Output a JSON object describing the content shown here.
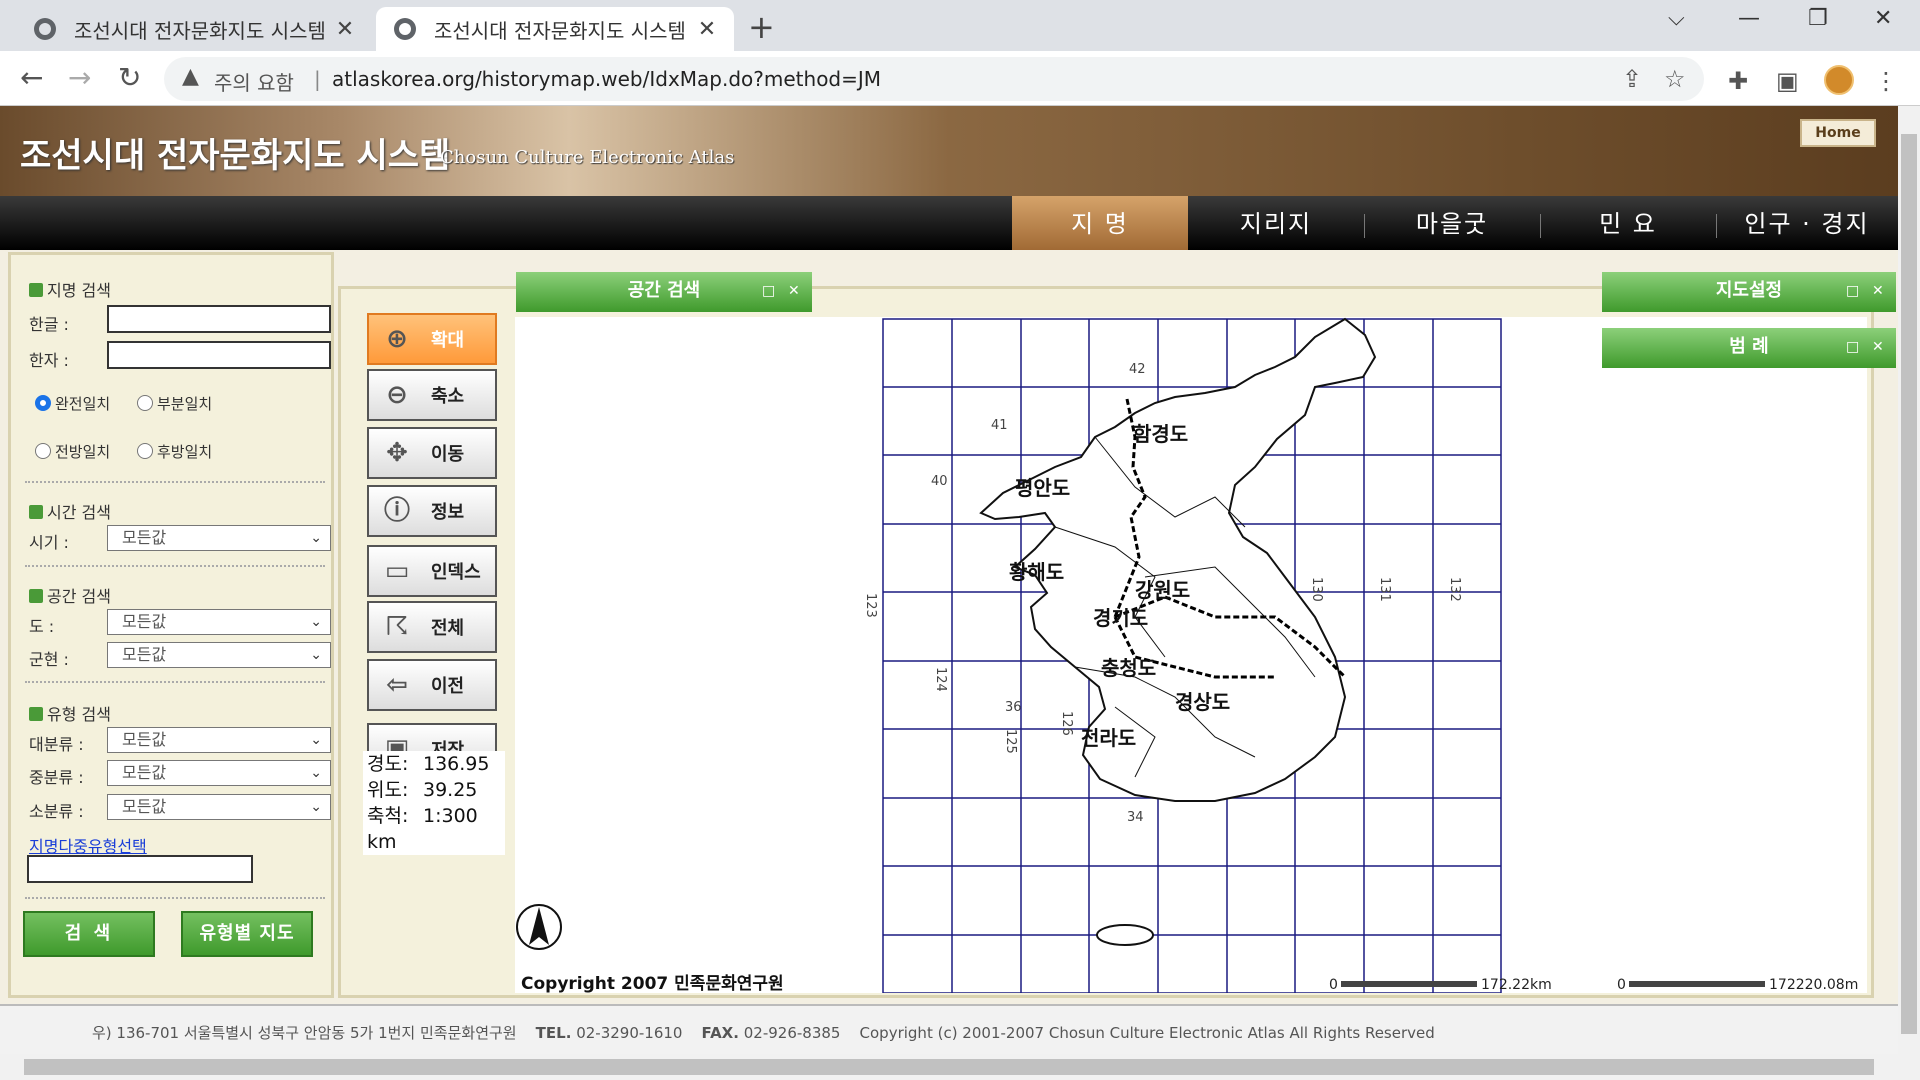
{
  "browser": {
    "tabs": [
      {
        "title": "조선시대 전자문화지도 시스템"
      },
      {
        "title": "조선시대 전자문화지도 시스템"
      }
    ],
    "warning": "주의 요함",
    "url": "atlaskorea.org/historymap.web/IdxMap.do?method=JM"
  },
  "site": {
    "title": "조선시대 전자문화지도 시스템",
    "subtitle": "Chosun Culture Electronic Atlas",
    "home": "Home",
    "menu": [
      "지 명",
      "지리지",
      "마을굿",
      "민 요",
      "인구 · 경지"
    ]
  },
  "search": {
    "name_section": "지명 검색",
    "hangul_label": "한글 :",
    "hanja_label": "한자 :",
    "match_options": [
      "완전일치",
      "부분일치",
      "전방일치",
      "후방일치"
    ],
    "time_section": "시간 검색",
    "period_label": "시기 :",
    "space_section": "공간 검색",
    "do_label": "도 :",
    "county_label": "군현 :",
    "type_section": "유형 검색",
    "major_label": "대분류 :",
    "middle_label": "중분류 :",
    "minor_label": "소분류 :",
    "default_option": "모든값",
    "multi_link": "지명다중유형선택",
    "search_button": "검 색",
    "type_map_button": "유형별 지도"
  },
  "tools": [
    "확대",
    "축소",
    "이동",
    "정보",
    "인덱스",
    "전체",
    "이전",
    "저장"
  ],
  "coords": {
    "lon_label": "경도:",
    "lon_value": "136.95",
    "lat_label": "위도:",
    "lat_value": "39.25",
    "scale_label": "축척:",
    "scale_value": "1:300 km"
  },
  "panels": {
    "space_search": "공간 검색",
    "map_settings": "지도설정",
    "legend": "범 례"
  },
  "map": {
    "provinces": [
      "함경도",
      "평안도",
      "황해도",
      "강원도",
      "경기도",
      "충청도",
      "경상도",
      "전라도"
    ],
    "lat_labels": [
      "42",
      "41",
      "40",
      "36",
      "34"
    ],
    "lon_labels": [
      "123",
      "124",
      "125",
      "126",
      "130",
      "131",
      "132"
    ],
    "copyright": "Copyright 2007 민족문화연구원",
    "scale1_zero": "0",
    "scale1": "172.22km",
    "scale2_zero": "0",
    "scale2": "172220.08m"
  },
  "footer": {
    "address": "우) 136-701  서울특별시 성북구 안암동 5가 1번지 민족문화연구원",
    "tel_label": "TEL.",
    "tel": "02-3290-1610",
    "fax_label": "FAX.",
    "fax": "02-926-8385",
    "copyright": "Copyright (c) 2001-2007 Chosun Culture Electronic Atlas  All Rights Reserved"
  }
}
